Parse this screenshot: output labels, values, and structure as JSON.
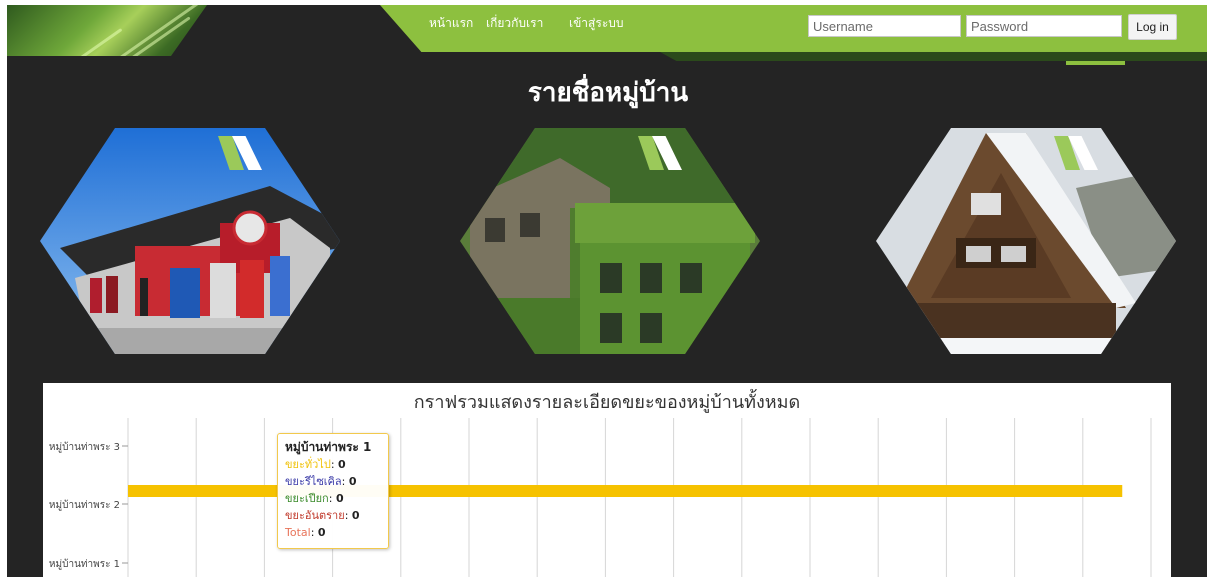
{
  "nav": {
    "items": [
      "หน้าแรก",
      "เกี่ยวกับเรา",
      "เข้าสู่ระบบ"
    ]
  },
  "login": {
    "username_placeholder": "Username",
    "password_placeholder": "Password",
    "button_label": "Log in"
  },
  "page": {
    "title": "รายชื่อหมู่บ้าน"
  },
  "villages": [
    {
      "image": "storefront-photo"
    },
    {
      "image": "ivy-covered-building-photo"
    },
    {
      "image": "thatched-roof-house-photo"
    }
  ],
  "colors": {
    "brand_green": "#8dc03f",
    "dark_green": "#2b4a1b",
    "background": "#242424",
    "bar": "#f6c200"
  },
  "chart_data": {
    "type": "bar",
    "orientation": "horizontal",
    "title": "กราฟรวมแสดงรายละเอียดขยะของหมู่บ้านทั้งหมด",
    "categories": [
      "หมู่บ้านท่าพระ 3",
      "หมู่บ้านท่าพระ 2",
      "หมู่บ้านท่าพระ 1"
    ],
    "series": [
      {
        "values": [
          null,
          0.97,
          null
        ],
        "color": "#f6c200"
      }
    ],
    "xlim": [
      0,
      1
    ],
    "grid": "vertical",
    "tooltip": {
      "title": "หมู่บ้านท่าพระ 1",
      "rows": [
        {
          "label": "ขยะทั่วไป",
          "value": "0",
          "color": "#f0c20a"
        },
        {
          "label": "ขยะรีไซเคิล",
          "value": "0",
          "color": "#3d3da8"
        },
        {
          "label": "ขยะเปียก",
          "value": "0",
          "color": "#3a8a2a"
        },
        {
          "label": "ขยะอันตราย",
          "value": "0",
          "color": "#c0392b"
        },
        {
          "label": "Total",
          "value": "0",
          "color": "#e8745a"
        }
      ]
    }
  }
}
